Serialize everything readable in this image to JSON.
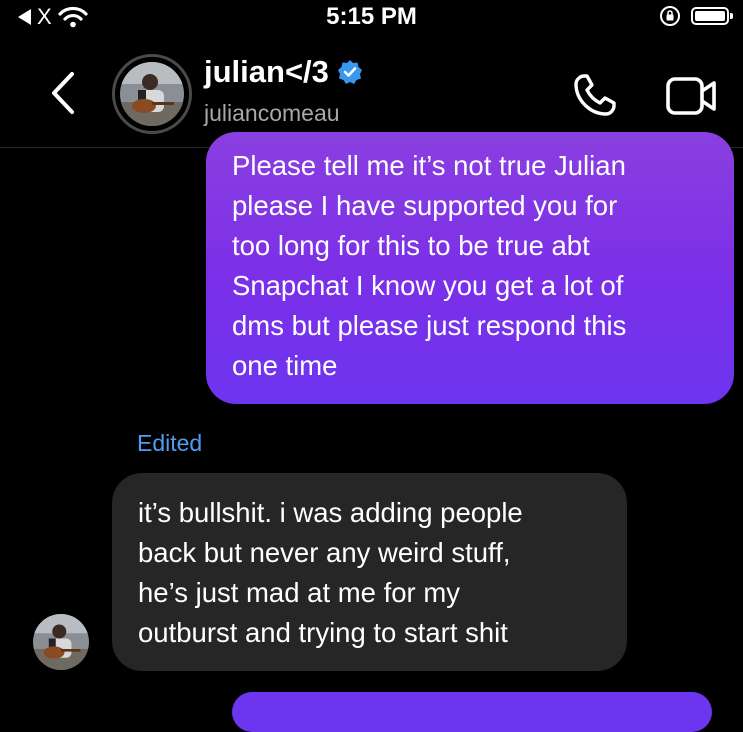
{
  "status_bar": {
    "carrier": "X",
    "time": "5:15 PM"
  },
  "header": {
    "name": "julian</3",
    "username": "juliancomeau",
    "verified": true
  },
  "messages": {
    "outgoing": {
      "lines": [
        "Please tell me it’s not true Julian",
        "please I have supported you for",
        "too long for this to be true abt",
        "Snapchat I know you get a lot of",
        "dms but please just respond this",
        "one time"
      ]
    },
    "edited_label": "Edited",
    "incoming": {
      "lines": [
        "it’s bullshit. i was adding people",
        "back but never any weird stuff,",
        "he’s just mad at me for my",
        "outburst and trying to start shit"
      ]
    }
  },
  "colors": {
    "outgoing_bubble": "#7b2fe8",
    "incoming_bubble": "#262626",
    "edited_label": "#4f9cf0",
    "verified_badge": "#3897f0",
    "secondary_text": "#a8a8a8"
  },
  "icons": {
    "back": "chevron-left-icon",
    "verified": "verified-badge-icon",
    "phone": "phone-icon",
    "video": "video-camera-icon",
    "wifi": "wifi-icon",
    "battery": "battery-icon",
    "rotation_lock": "rotation-lock-icon"
  }
}
